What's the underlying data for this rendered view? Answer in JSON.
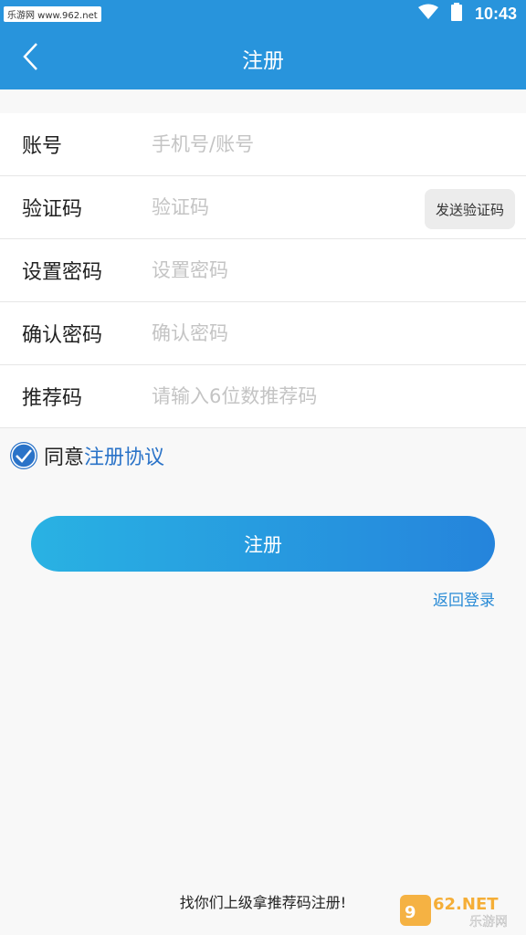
{
  "status_bar": {
    "site_tag": "乐游网 www.962.net",
    "time": "10:43"
  },
  "nav": {
    "title": "注册",
    "back_icon": "chevron-left-icon"
  },
  "form": {
    "rows": [
      {
        "label": "账号",
        "placeholder": "手机号/账号",
        "value": ""
      },
      {
        "label": "验证码",
        "placeholder": "验证码",
        "value": ""
      },
      {
        "label": "设置密码",
        "placeholder": "设置密码",
        "value": ""
      },
      {
        "label": "确认密码",
        "placeholder": "确认密码",
        "value": ""
      },
      {
        "label": "推荐码",
        "placeholder": "请输入6位数推荐码",
        "value": ""
      }
    ],
    "send_code_label": "发送验证码"
  },
  "agreement": {
    "checked": true,
    "prefix": "同意",
    "link": "注册协议"
  },
  "actions": {
    "register_label": "注册",
    "back_login_label": "返回登录"
  },
  "footer": {
    "hint": "找你们上级拿推荐码注册!"
  },
  "watermark": {
    "brand": "962.NET",
    "name": "乐游网"
  },
  "colors": {
    "primary": "#2894dc",
    "gradient_start": "#29b2e3",
    "gradient_end": "#2584dc",
    "link": "#2a73c8"
  }
}
